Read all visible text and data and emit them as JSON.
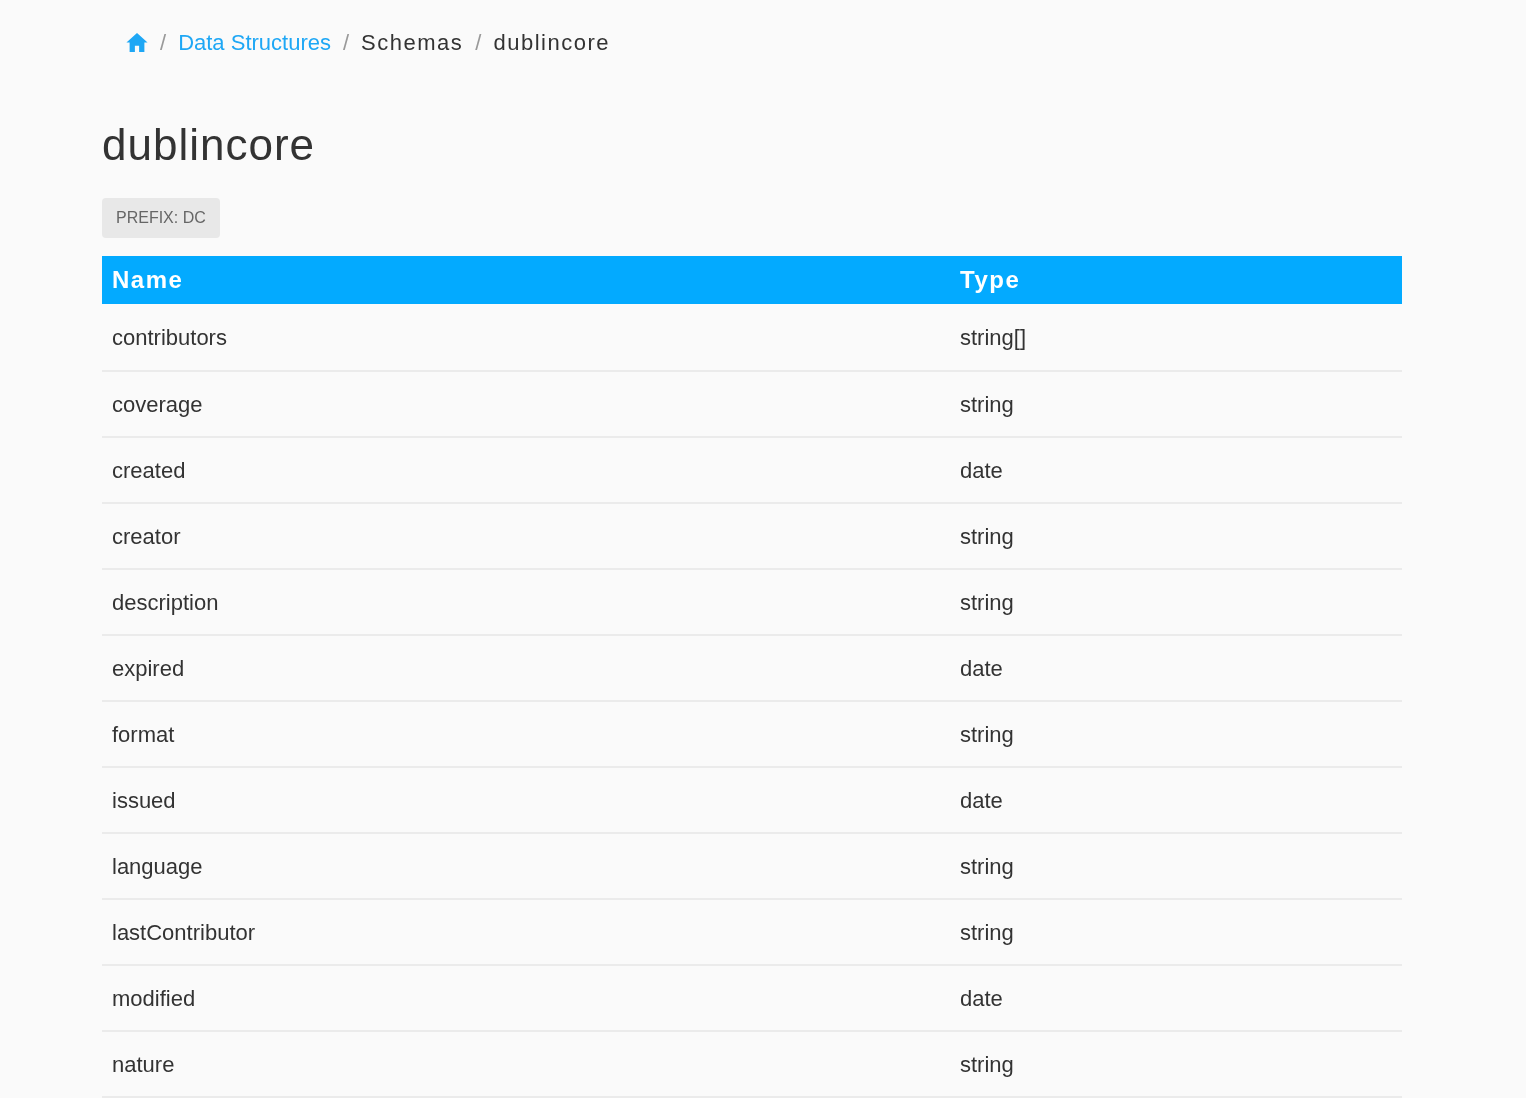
{
  "breadcrumb": [
    {
      "kind": "home"
    },
    {
      "kind": "separator",
      "text": "/"
    },
    {
      "kind": "link",
      "text": "Data Structures"
    },
    {
      "kind": "separator",
      "text": "/"
    },
    {
      "kind": "text",
      "text": "Schemas"
    },
    {
      "kind": "separator",
      "text": "/"
    },
    {
      "kind": "text",
      "text": "dublincore"
    }
  ],
  "title": "dublincore",
  "badge": "PREFIX: DC",
  "table": {
    "columns": [
      "Name",
      "Type"
    ],
    "rows": [
      [
        "contributors",
        "string[]"
      ],
      [
        "coverage",
        "string"
      ],
      [
        "created",
        "date"
      ],
      [
        "creator",
        "string"
      ],
      [
        "description",
        "string"
      ],
      [
        "expired",
        "date"
      ],
      [
        "format",
        "string"
      ],
      [
        "issued",
        "date"
      ],
      [
        "language",
        "string"
      ],
      [
        "lastContributor",
        "string"
      ],
      [
        "modified",
        "date"
      ],
      [
        "nature",
        "string"
      ]
    ]
  }
}
